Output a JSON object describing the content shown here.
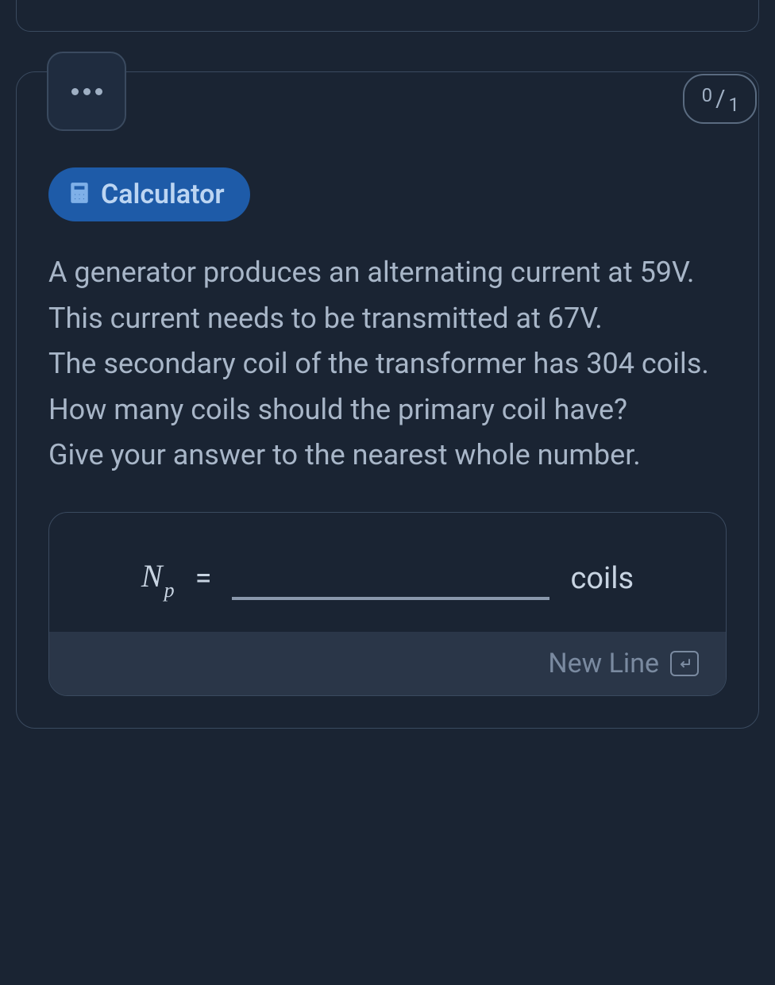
{
  "score": {
    "numerator": "0",
    "denominator": "1"
  },
  "calculator": {
    "label": "Calculator"
  },
  "question": {
    "line1": "A generator produces an alternating current at 59V.",
    "line2": "This current needs to be transmitted at 67V.",
    "line3": "The secondary coil of the transformer has 304 coils.",
    "line4": "How many coils should the primary coil have?",
    "line5": "Give your answer to the nearest whole number."
  },
  "answer": {
    "variable_base": "N",
    "variable_sub": "p",
    "equals": "=",
    "value": "",
    "unit": "coils"
  },
  "newline": {
    "label": "New Line"
  }
}
